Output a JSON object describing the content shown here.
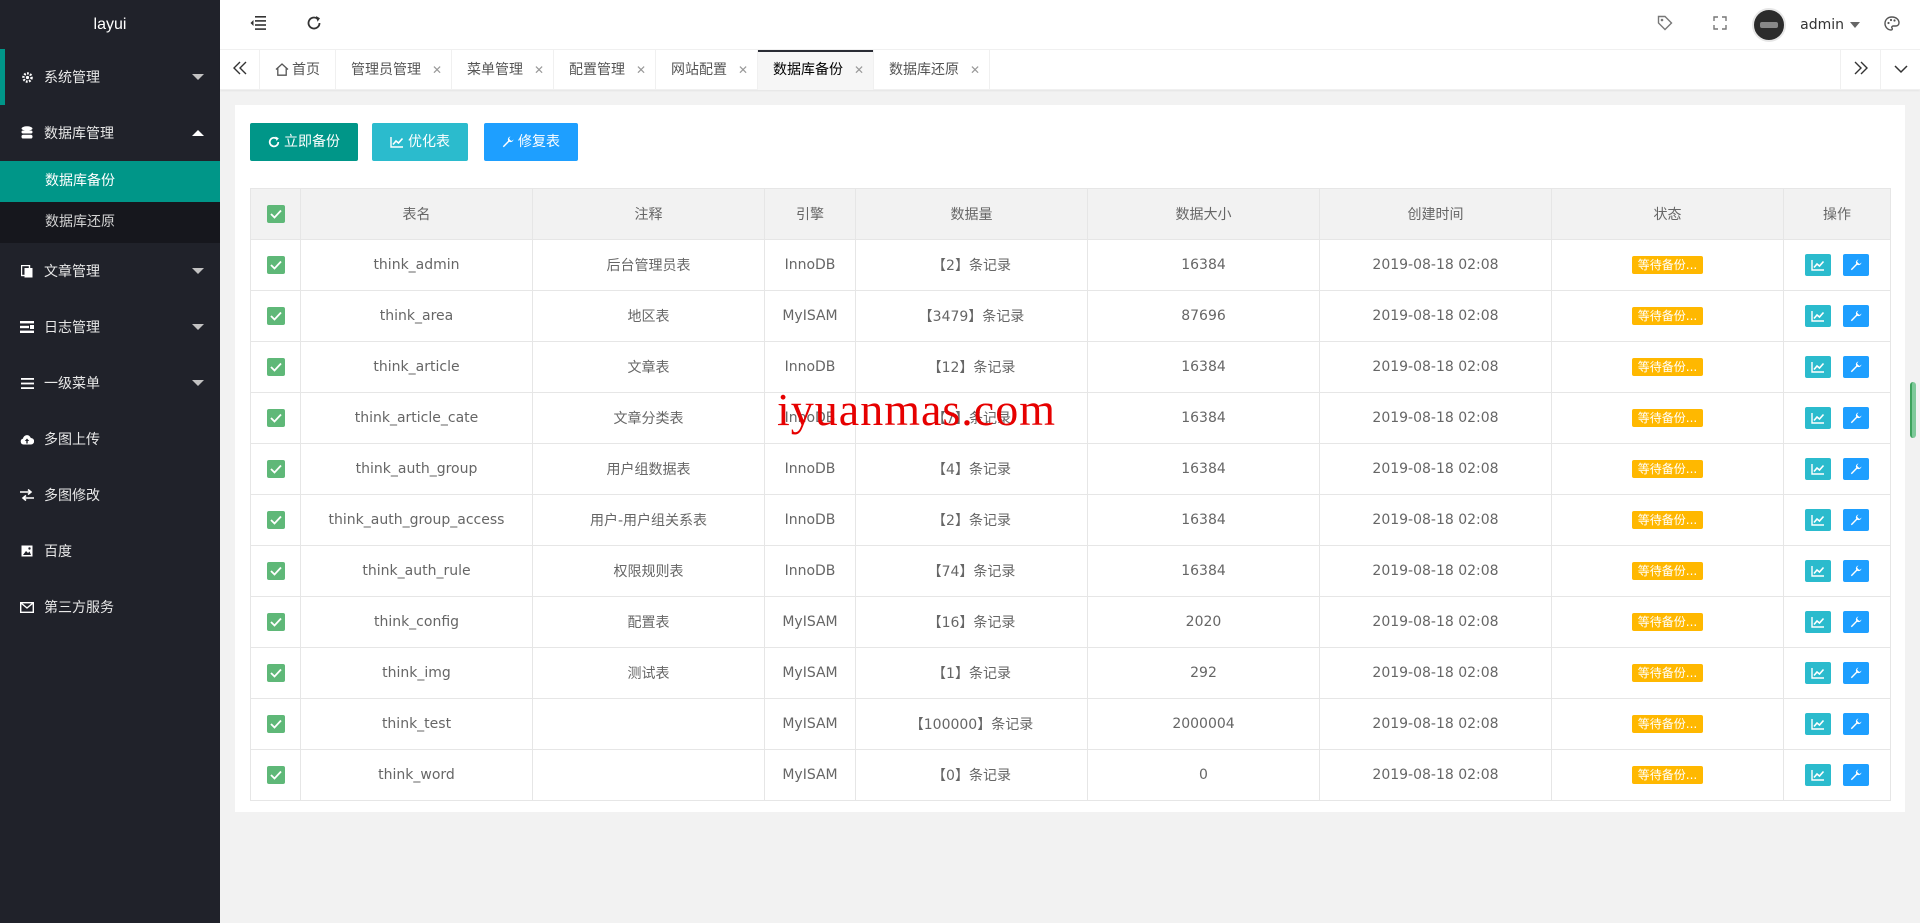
{
  "app": {
    "logo": "layui"
  },
  "sidebar": {
    "items": [
      {
        "label": "系统管理",
        "icon": "gear-icon"
      },
      {
        "label": "数据库管理",
        "icon": "database-icon"
      },
      {
        "label": "文章管理",
        "icon": "file-icon"
      },
      {
        "label": "日志管理",
        "icon": "log-icon"
      },
      {
        "label": "一级菜单",
        "icon": "menu-icon"
      },
      {
        "label": "多图上传",
        "icon": "cloud-upload-icon"
      },
      {
        "label": "多图修改",
        "icon": "exchange-icon"
      },
      {
        "label": "百度",
        "icon": "image-icon"
      },
      {
        "label": "第三方服务",
        "icon": "mail-icon"
      }
    ],
    "sub_items": [
      {
        "label": "数据库备份"
      },
      {
        "label": "数据库还原"
      }
    ]
  },
  "header": {
    "user": "admin"
  },
  "tabs": [
    {
      "label": "首页"
    },
    {
      "label": "管理员管理"
    },
    {
      "label": "菜单管理"
    },
    {
      "label": "配置管理"
    },
    {
      "label": "网站配置"
    },
    {
      "label": "数据库备份"
    },
    {
      "label": "数据库还原"
    }
  ],
  "toolbar": {
    "backup_label": "立即备份",
    "optimize_label": "优化表",
    "repair_label": "修复表"
  },
  "table": {
    "headers": [
      "表名",
      "注释",
      "引擎",
      "数据量",
      "数据大小",
      "创建时间",
      "状态",
      "操作"
    ],
    "rows": [
      {
        "name": "think_admin",
        "comment": "后台管理员表",
        "engine": "InnoDB",
        "count": "【2】条记录",
        "size": "16384",
        "created": "2019-08-18 02:08",
        "status": "等待备份..."
      },
      {
        "name": "think_area",
        "comment": "地区表",
        "engine": "MyISAM",
        "count": "【3479】条记录",
        "size": "87696",
        "created": "2019-08-18 02:08",
        "status": "等待备份..."
      },
      {
        "name": "think_article",
        "comment": "文章表",
        "engine": "InnoDB",
        "count": "【12】条记录",
        "size": "16384",
        "created": "2019-08-18 02:08",
        "status": "等待备份..."
      },
      {
        "name": "think_article_cate",
        "comment": "文章分类表",
        "engine": "InnoDB",
        "count": "【7】条记录",
        "size": "16384",
        "created": "2019-08-18 02:08",
        "status": "等待备份..."
      },
      {
        "name": "think_auth_group",
        "comment": "用户组数据表",
        "engine": "InnoDB",
        "count": "【4】条记录",
        "size": "16384",
        "created": "2019-08-18 02:08",
        "status": "等待备份..."
      },
      {
        "name": "think_auth_group_access",
        "comment": "用户-用户组关系表",
        "engine": "InnoDB",
        "count": "【2】条记录",
        "size": "16384",
        "created": "2019-08-18 02:08",
        "status": "等待备份..."
      },
      {
        "name": "think_auth_rule",
        "comment": "权限规则表",
        "engine": "InnoDB",
        "count": "【74】条记录",
        "size": "16384",
        "created": "2019-08-18 02:08",
        "status": "等待备份..."
      },
      {
        "name": "think_config",
        "comment": "配置表",
        "engine": "MyISAM",
        "count": "【16】条记录",
        "size": "2020",
        "created": "2019-08-18 02:08",
        "status": "等待备份..."
      },
      {
        "name": "think_img",
        "comment": "测试表",
        "engine": "MyISAM",
        "count": "【1】条记录",
        "size": "292",
        "created": "2019-08-18 02:08",
        "status": "等待备份..."
      },
      {
        "name": "think_test",
        "comment": "",
        "engine": "MyISAM",
        "count": "【100000】条记录",
        "size": "2000004",
        "created": "2019-08-18 02:08",
        "status": "等待备份..."
      },
      {
        "name": "think_word",
        "comment": "",
        "engine": "MyISAM",
        "count": "【0】条记录",
        "size": "0",
        "created": "2019-08-18 02:08",
        "status": "等待备份..."
      }
    ]
  },
  "watermark": "iyuanmas.com",
  "colors": {
    "sidebar_bg": "#20222a",
    "accent": "#009688",
    "status_badge": "#ffb800",
    "checkbox": "#5fb878",
    "optimize_btn": "#2bbbcd",
    "repair_btn": "#1e9fff"
  }
}
